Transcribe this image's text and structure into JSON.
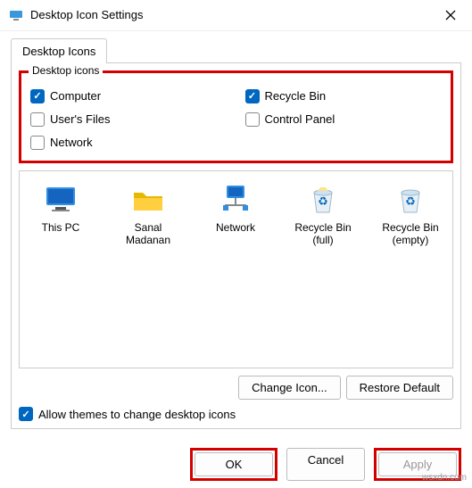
{
  "title": "Desktop Icon Settings",
  "tab": "Desktop Icons",
  "group": {
    "legend": "Desktop icons",
    "checks": {
      "computer": {
        "label": "Computer",
        "checked": true
      },
      "recycle": {
        "label": "Recycle Bin",
        "checked": true
      },
      "users": {
        "label": "User's Files",
        "checked": false
      },
      "control": {
        "label": "Control Panel",
        "checked": false
      },
      "network": {
        "label": "Network",
        "checked": false
      }
    }
  },
  "icons": {
    "thispc": {
      "label": "This PC"
    },
    "userfolder": {
      "label": "Sanal Madanan"
    },
    "network": {
      "label": "Network"
    },
    "rb_full": {
      "label": "Recycle Bin (full)"
    },
    "rb_empty": {
      "label": "Recycle Bin (empty)"
    }
  },
  "buttons": {
    "change_icon": "Change Icon...",
    "restore_default": "Restore Default",
    "ok": "OK",
    "cancel": "Cancel",
    "apply": "Apply"
  },
  "allow_themes": {
    "label": "Allow themes to change desktop icons",
    "checked": true
  },
  "watermark": "wsxdn.com"
}
